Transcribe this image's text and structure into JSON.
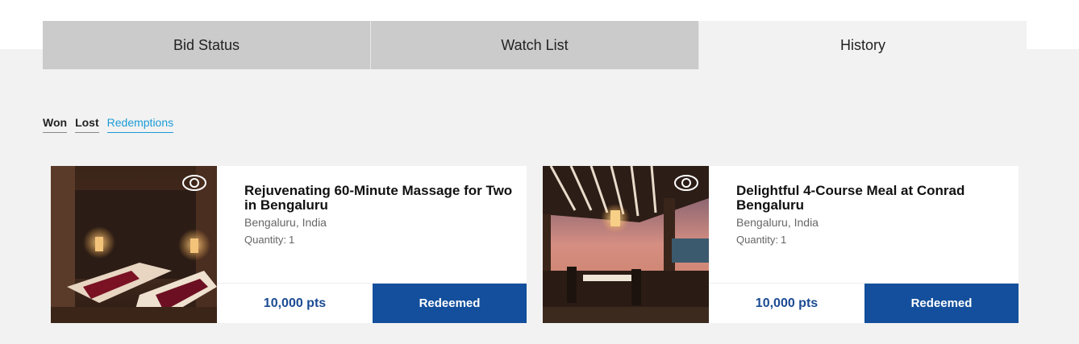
{
  "tabs": [
    {
      "label": "Bid Status"
    },
    {
      "label": "Watch List"
    },
    {
      "label": "History"
    }
  ],
  "subtabs": [
    {
      "label": "Won"
    },
    {
      "label": "Lost"
    },
    {
      "label": "Redemptions"
    }
  ],
  "cards": [
    {
      "title": "Rejuvenating 60-Minute Massage for Two in Bengaluru",
      "location": "Bengaluru, India",
      "quantity_label": "Quantity:",
      "quantity": "1",
      "points": "10,000 pts",
      "status": "Redeemed",
      "icon": "eye-icon"
    },
    {
      "title": "Delightful 4-Course Meal at Conrad Bengaluru",
      "location": "Bengaluru, India",
      "quantity_label": "Quantity:",
      "quantity": "1",
      "points": "10,000 pts",
      "status": "Redeemed",
      "icon": "eye-icon"
    }
  ],
  "colors": {
    "accent": "#1a9bd7",
    "button": "#134f9c",
    "points": "#1b4b93",
    "tab_inactive": "#cbcbcb",
    "background": "#f2f2f2"
  }
}
